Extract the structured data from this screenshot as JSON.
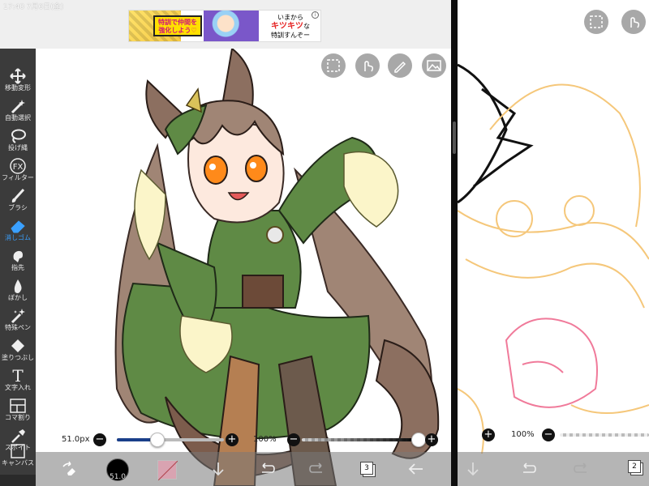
{
  "status": {
    "time": "17:40 7月6日(金)"
  },
  "ad": {
    "banner_line1": "特訓で仲間を",
    "banner_line2": "強化しよう♡",
    "right_line1": "いまから",
    "right_line2": "キツキツ",
    "right_line3": "な",
    "right_line4": "特訓すんぞー",
    "info": "i"
  },
  "tools": [
    {
      "label": "移動変形",
      "icon": "move-icon"
    },
    {
      "label": "自動選択",
      "icon": "magic-wand-icon"
    },
    {
      "label": "投げ縄",
      "icon": "lasso-icon"
    },
    {
      "label": "フィルター",
      "icon": "fx-icon",
      "glyph": "FX"
    },
    {
      "label": "ブラシ",
      "icon": "brush-icon"
    },
    {
      "label": "消しゴム",
      "icon": "eraser-icon",
      "active": true
    },
    {
      "label": "指先",
      "icon": "smudge-icon"
    },
    {
      "label": "ぼかし",
      "icon": "blur-icon"
    },
    {
      "label": "特殊ペン",
      "icon": "special-pen-icon"
    },
    {
      "label": "塗りつぶし",
      "icon": "fill-bucket-icon"
    },
    {
      "label": "文字入れ",
      "icon": "text-icon",
      "glyph": "T"
    },
    {
      "label": "コマ割り",
      "icon": "frame-divide-icon"
    },
    {
      "label": "スポイト",
      "icon": "eyedropper-icon"
    },
    {
      "label": "キャンバス",
      "icon": "canvas-icon"
    }
  ],
  "canvas_tools": [
    "selection-icon",
    "hand-gesture-icon",
    "pen-icon",
    "image-icon"
  ],
  "brush": {
    "size_label": "51.0px",
    "size_fraction": 0.38,
    "opacity_label": "100%",
    "opacity_fraction": 1.0,
    "size_badge": "51.0",
    "minus": "−",
    "plus": "+"
  },
  "bottom": {
    "color_hex": "#d9a3b1",
    "layers": "3"
  },
  "right_pane": {
    "opacity_label": "100%",
    "layers": "2"
  },
  "colors": {
    "accent": "#3aa0ff",
    "panel": "#3b3b3b"
  }
}
